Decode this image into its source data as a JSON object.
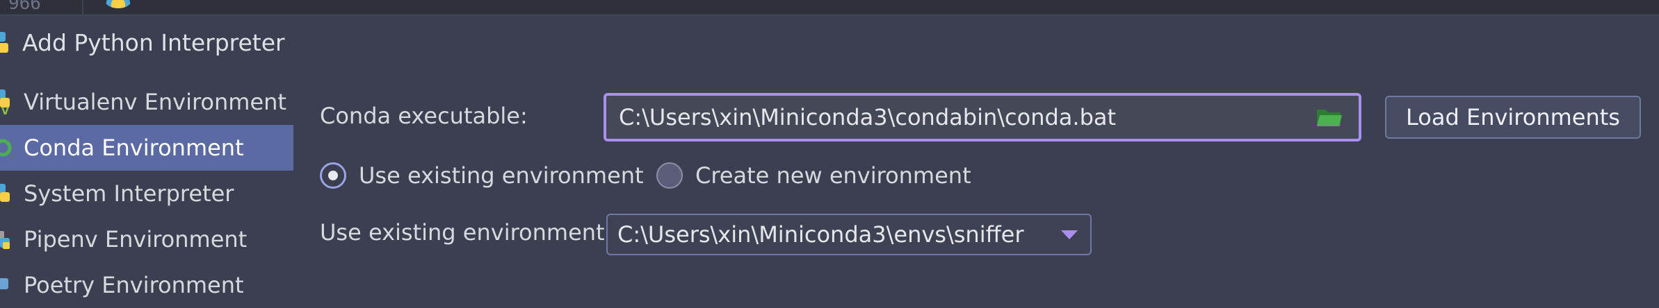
{
  "background_strip": {
    "line_number": "966"
  },
  "dialog": {
    "title": "Add Python Interpreter"
  },
  "sidebar": {
    "items": [
      {
        "label": "Virtualenv Environment",
        "icon": "virtualenv-icon",
        "selected": false
      },
      {
        "label": "Conda Environment",
        "icon": "conda-icon",
        "selected": true
      },
      {
        "label": "System Interpreter",
        "icon": "python-icon",
        "selected": false
      },
      {
        "label": "Pipenv Environment",
        "icon": "pipenv-icon",
        "selected": false
      },
      {
        "label": "Poetry Environment",
        "icon": "poetry-icon",
        "selected": false
      }
    ]
  },
  "form": {
    "conda_executable_label": "Conda executable:",
    "conda_executable_value": "C:\\Users\\xin\\Miniconda3\\condabin\\conda.bat",
    "load_environments_label": "Load Environments",
    "radio_use_existing_label": "Use existing environment",
    "radio_create_new_label": "Create new environment",
    "selected_radio": "use_existing",
    "existing_env_label": "Use existing environment:",
    "existing_env_value": "C:\\Users\\xin\\Miniconda3\\envs\\sniffer"
  },
  "colors": {
    "background": "#3c3f4f",
    "selection": "#5c6aa3",
    "focus_border": "#a98ff0",
    "folder_icon": "#4caf50"
  }
}
